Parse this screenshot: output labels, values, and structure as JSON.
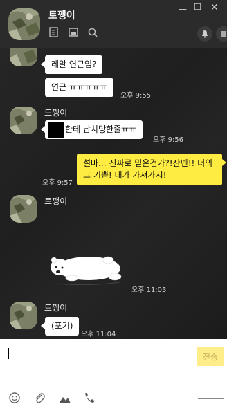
{
  "header": {
    "title": "토깽이"
  },
  "messages": [
    {
      "text": "레알 연근임?"
    },
    {
      "text": "연근 ㅠㅠㅠㅠㅠ",
      "time": "오후 9:55"
    },
    {
      "sender": "토깽이",
      "text": "한테 납치당한줄ㅠㅠ",
      "time": "오후 9:56"
    },
    {
      "text": "설마... 진짜로 믿은건가?!잔넨!! 너의 그 기쁨! 내가 가져가지!",
      "time": "오후 9:57"
    },
    {
      "sender": "토깽이",
      "time": "오후 11:03"
    },
    {
      "sender": "토깽이",
      "text": "(포기)",
      "time": "오후 11:04"
    }
  ],
  "composer": {
    "send_label": "전송"
  },
  "icons": {
    "header": [
      "file-icon",
      "box-icon",
      "search-icon",
      "bell-icon",
      "menu-icon"
    ],
    "bottom": [
      "emoji-icon",
      "attach-icon",
      "image-icon",
      "phone-icon"
    ]
  }
}
